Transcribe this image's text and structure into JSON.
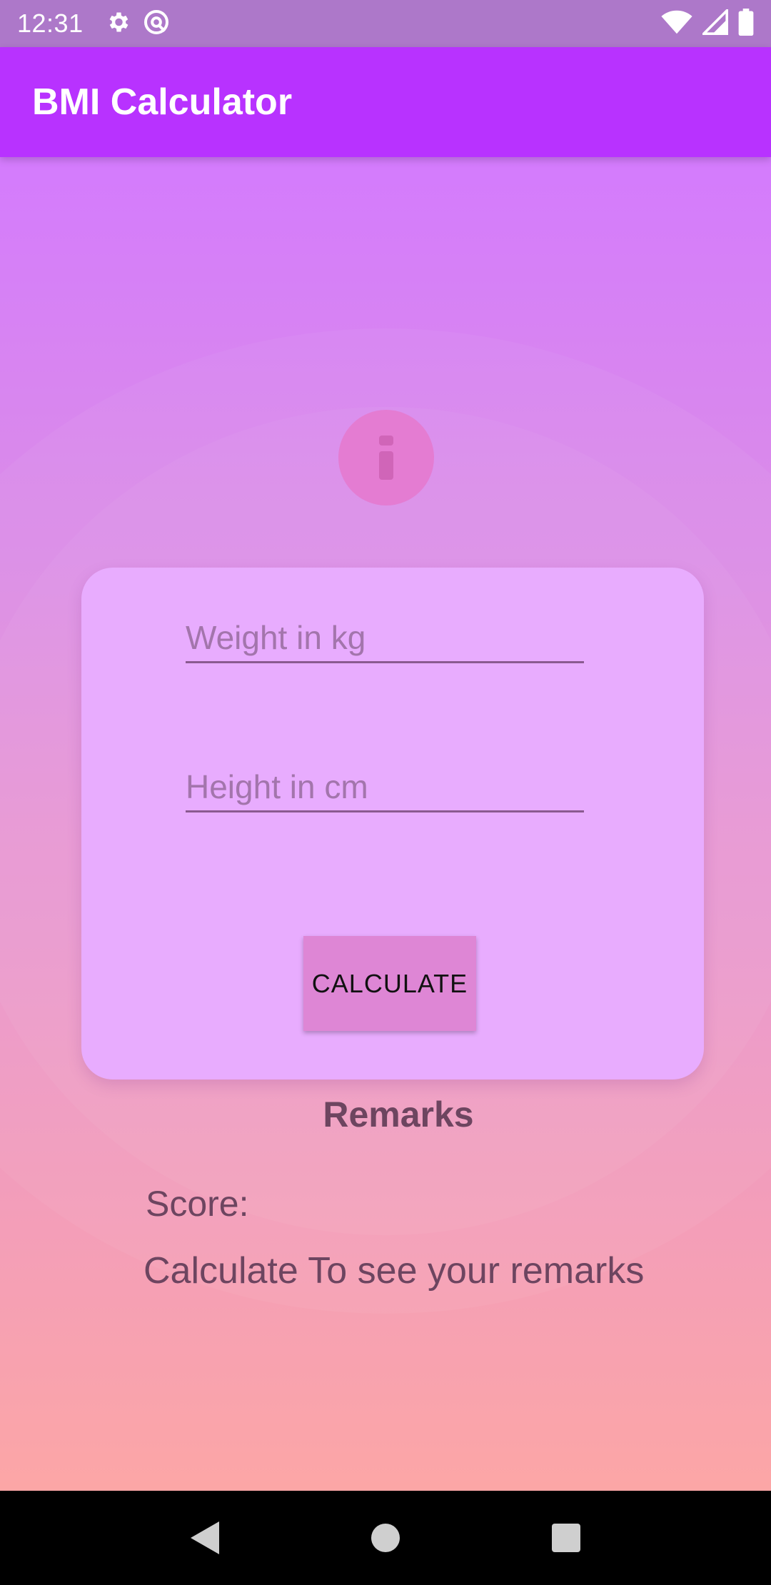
{
  "status_bar": {
    "time": "12:31",
    "icons_left": [
      "gear-icon",
      "at-sign-icon"
    ],
    "icons_right": [
      "wifi-icon",
      "signal-icon",
      "battery-icon"
    ]
  },
  "app_bar": {
    "title": "BMI Calculator"
  },
  "info_icon": "info-icon",
  "form": {
    "weight": {
      "value": "",
      "placeholder": "Weight in kg"
    },
    "height": {
      "value": "",
      "placeholder": "Height in cm"
    },
    "calculate_label": "CALCULATE"
  },
  "results": {
    "remarks_title": "Remarks",
    "score_label": "Score:",
    "remarks_text": "Calculate To see your remarks"
  },
  "nav_bar": {
    "buttons": [
      "back-icon",
      "home-icon",
      "recents-icon"
    ]
  },
  "colors": {
    "app_bar": "#b832ff",
    "card": "#e8acfe",
    "button": "#de86d5",
    "info_circle": "#e47cd2",
    "gradient_top": "#d47bfd",
    "gradient_bottom": "#fca6a6"
  }
}
